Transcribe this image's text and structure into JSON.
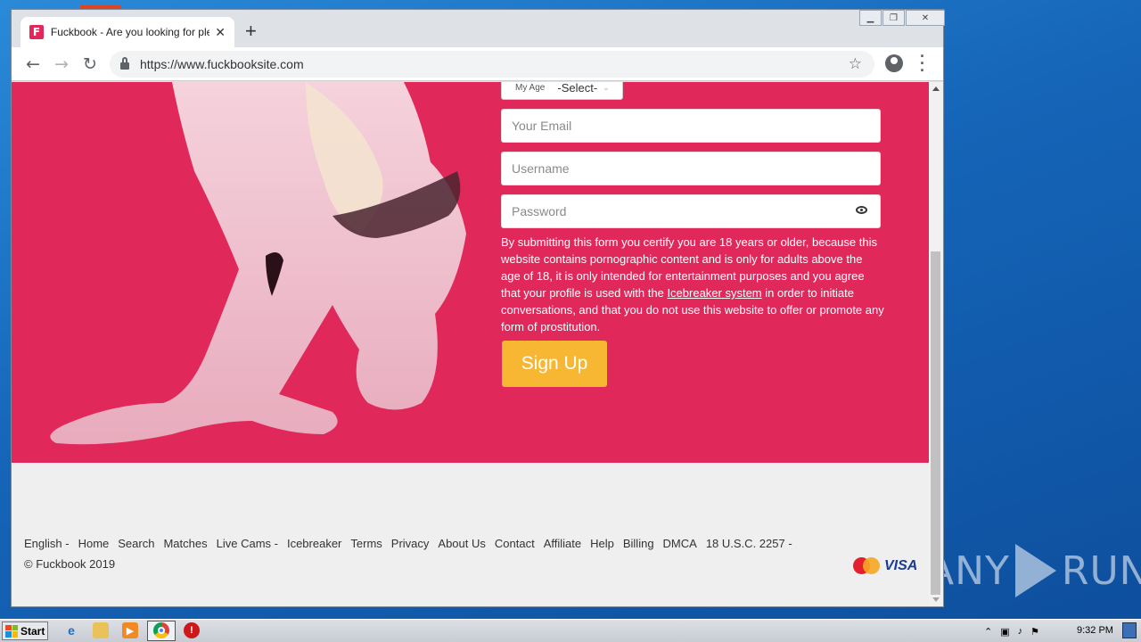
{
  "browser": {
    "tab_title": "Fuckbook - Are you looking for pleas",
    "favicon_letter": "F",
    "url": "https://www.fuckbooksite.com"
  },
  "form": {
    "age_label": "My Age",
    "age_value": "-Select-",
    "email_placeholder": "Your Email",
    "username_placeholder": "Username",
    "password_placeholder": "Password",
    "legal_before": "By submitting this form you certify you are 18 years or older, because this website contains pornographic content and is only for adults above the age of 18, it is only intended for entertainment purposes and you agree that your profile is used with the ",
    "legal_link": "Icebreaker system",
    "legal_after": " in order to initiate conversations, and that you do not use this website to offer or promote any form of prostitution.",
    "signup_label": "Sign Up"
  },
  "footer": {
    "links": [
      "English  -",
      "Home",
      "Search",
      "Matches",
      "Live Cams  -",
      "Icebreaker",
      "Terms",
      "Privacy",
      "About Us",
      "Contact",
      "Affiliate",
      "Help",
      "Billing",
      "DMCA",
      "18 U.S.C. 2257  -"
    ],
    "copyright": "© Fuckbook 2019",
    "visa": "VISA"
  },
  "watermark": "ANY RUN",
  "taskbar": {
    "start_label": "Start",
    "clock": "9:32 PM"
  },
  "colors": {
    "hero": "#e0295a",
    "signup": "#f7b733"
  }
}
